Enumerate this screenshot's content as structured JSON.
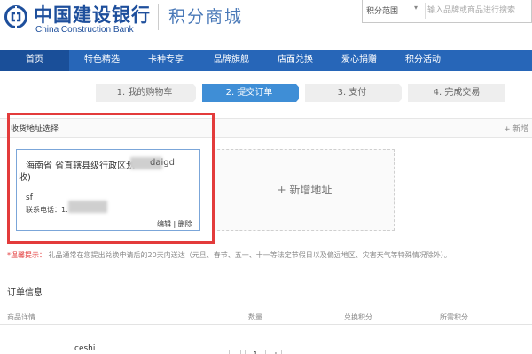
{
  "header": {
    "bank_name_cn": "中国建设银行",
    "bank_name_en": "China Construction Bank",
    "mall_title": "积分商城",
    "search_scope": "积分范围",
    "search_placeholder": "输入品牌或商品进行搜索"
  },
  "nav": {
    "items": [
      {
        "label": "首页",
        "active": true
      },
      {
        "label": "特色精选"
      },
      {
        "label": "卡种专享"
      },
      {
        "label": "品牌旗舰"
      },
      {
        "label": "店面兑换"
      },
      {
        "label": "爱心捐赠"
      },
      {
        "label": "积分活动"
      }
    ]
  },
  "steps": [
    {
      "label": "1. 我的购物车"
    },
    {
      "label": "2. 提交订单",
      "active": true
    },
    {
      "label": "3. 支付"
    },
    {
      "label": "4. 完成交易"
    }
  ],
  "address": {
    "section_title": "收货地址选择",
    "new_link": "+ 新增",
    "card": {
      "line1": "海南省 省直辖县级行政区划",
      "line1_tail": "daigd",
      "line2": "收)",
      "name": "sf",
      "phone_label": "联系电话：1.",
      "edit": "编辑",
      "separator": "|",
      "delete": "删除"
    },
    "add_label": "+ 新增地址"
  },
  "tip": {
    "label": "*温馨提示：",
    "text": "礼品通常在您提出兑换申请后的20天内送达（元旦、春节、五一、十一等法定节假日以及偏远地区、灾害天气等特殊情况除外）。"
  },
  "order": {
    "title": "订单信息",
    "columns": [
      "商品详情",
      "数量",
      "兑换积分",
      "所需积分"
    ],
    "item_name": "ceshi",
    "quantity": "1"
  },
  "colors": {
    "nav_bg": "#2766b8",
    "step_active": "#3f8ed6",
    "highlight_frame": "#e33b3b",
    "brand_blue": "#1e4f9c"
  }
}
